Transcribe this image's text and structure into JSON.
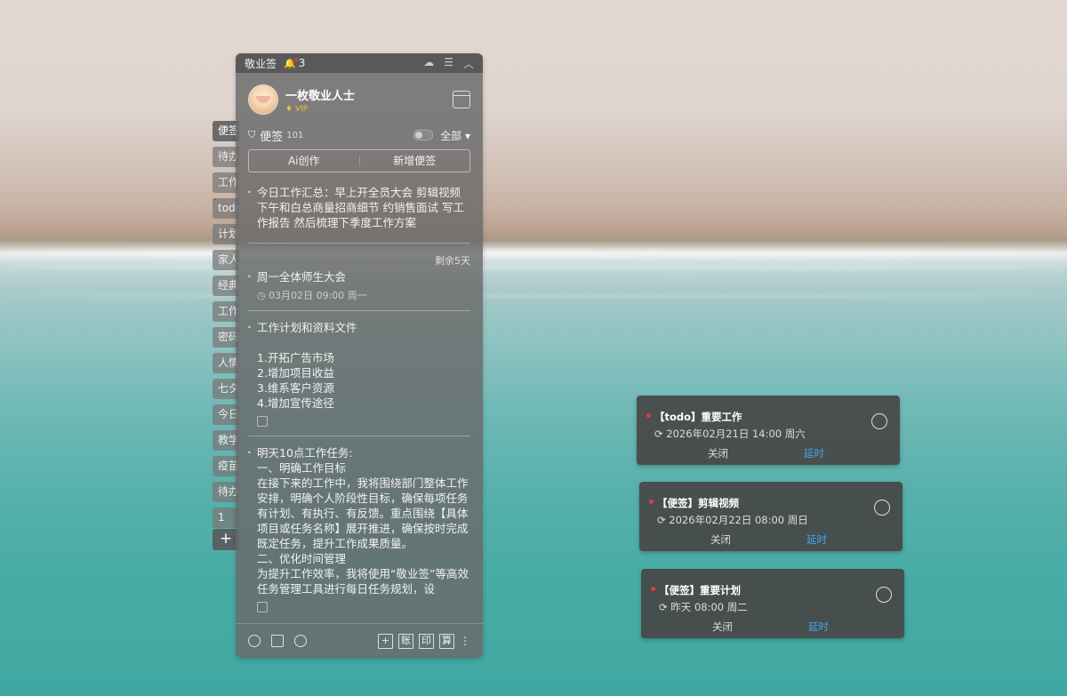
{
  "app": {
    "title": "敬业签",
    "bell_count": "3"
  },
  "user": {
    "name": "一枚敬业人士",
    "badge": "VIP"
  },
  "section": {
    "title": "便签",
    "count": "101",
    "filter": "全部 ▾"
  },
  "actions": {
    "ai": "Ai创作",
    "new": "新增便签"
  },
  "side_tabs": [
    {
      "label": "便签",
      "active": true,
      "dot": true
    },
    {
      "label": "待办",
      "active": false,
      "dot": false
    },
    {
      "label": "工作",
      "active": false,
      "dot": false
    },
    {
      "label": "todo",
      "active": false,
      "dot": true
    },
    {
      "label": "计划",
      "active": false,
      "dot": false
    },
    {
      "label": "家人",
      "active": false,
      "dot": false
    },
    {
      "label": "经典",
      "active": false,
      "dot": false
    },
    {
      "label": "工作",
      "active": false,
      "dot": false
    },
    {
      "label": "密码",
      "active": false,
      "dot": false
    },
    {
      "label": "人情",
      "active": false,
      "dot": false
    },
    {
      "label": "七夕",
      "active": false,
      "dot": false
    },
    {
      "label": "今日",
      "active": false,
      "dot": false
    },
    {
      "label": "教学",
      "active": false,
      "dot": false
    },
    {
      "label": "疫苗",
      "active": false,
      "dot": false
    },
    {
      "label": "待办",
      "active": false,
      "dot": false
    },
    {
      "label": "1",
      "active": false,
      "dot": false
    }
  ],
  "notes": [
    {
      "text": "今日工作汇总：早上开全员大会 剪辑视频 下午和白总商量招商细节 约销售面试 写工作报告 然后梳理下季度工作方案"
    },
    {
      "remain": "剩余5天",
      "text": "周一全体师生大会",
      "meta": "03月02日 09:00 周一"
    },
    {
      "text": "工作计划和资料文件",
      "lines": [
        "1.开拓广告市场",
        "2.增加项目收益",
        "3.维系客户资源",
        "4.增加宣传途径"
      ]
    },
    {
      "text": "明天10点工作任务:",
      "lines": [
        "一、明确工作目标",
        "在接下来的工作中，我将围绕部门整体工作安排，明确个人阶段性目标，确保每项任务有计划、有执行、有反馈。重点围绕【具体项目或任务名称】展开推进，确保按时完成既定任务，提升工作成果质量。",
        "二、优化时间管理",
        "为提升工作效率，我将使用“敬业签”等高效任务管理工具进行每日任务规划，设"
      ]
    }
  ],
  "bottom": {
    "b1": "账",
    "b2": "印",
    "b3": "算",
    "plus": "+"
  },
  "reminders": [
    {
      "title": "【todo】重要工作",
      "time": "2026年02月21日 14:00 周六",
      "close": "关闭",
      "delay": "延时"
    },
    {
      "title": "【便签】剪辑视频",
      "time": "2026年02月22日 08:00 周日",
      "close": "关闭",
      "delay": "延时"
    },
    {
      "title": "【便签】重要计划",
      "time": "昨天 08:00 周二",
      "close": "关闭",
      "delay": "延时"
    }
  ],
  "colors": {
    "accent": "#4aa3e8",
    "dot": "#e23b3b",
    "vip": "#f5b942"
  }
}
